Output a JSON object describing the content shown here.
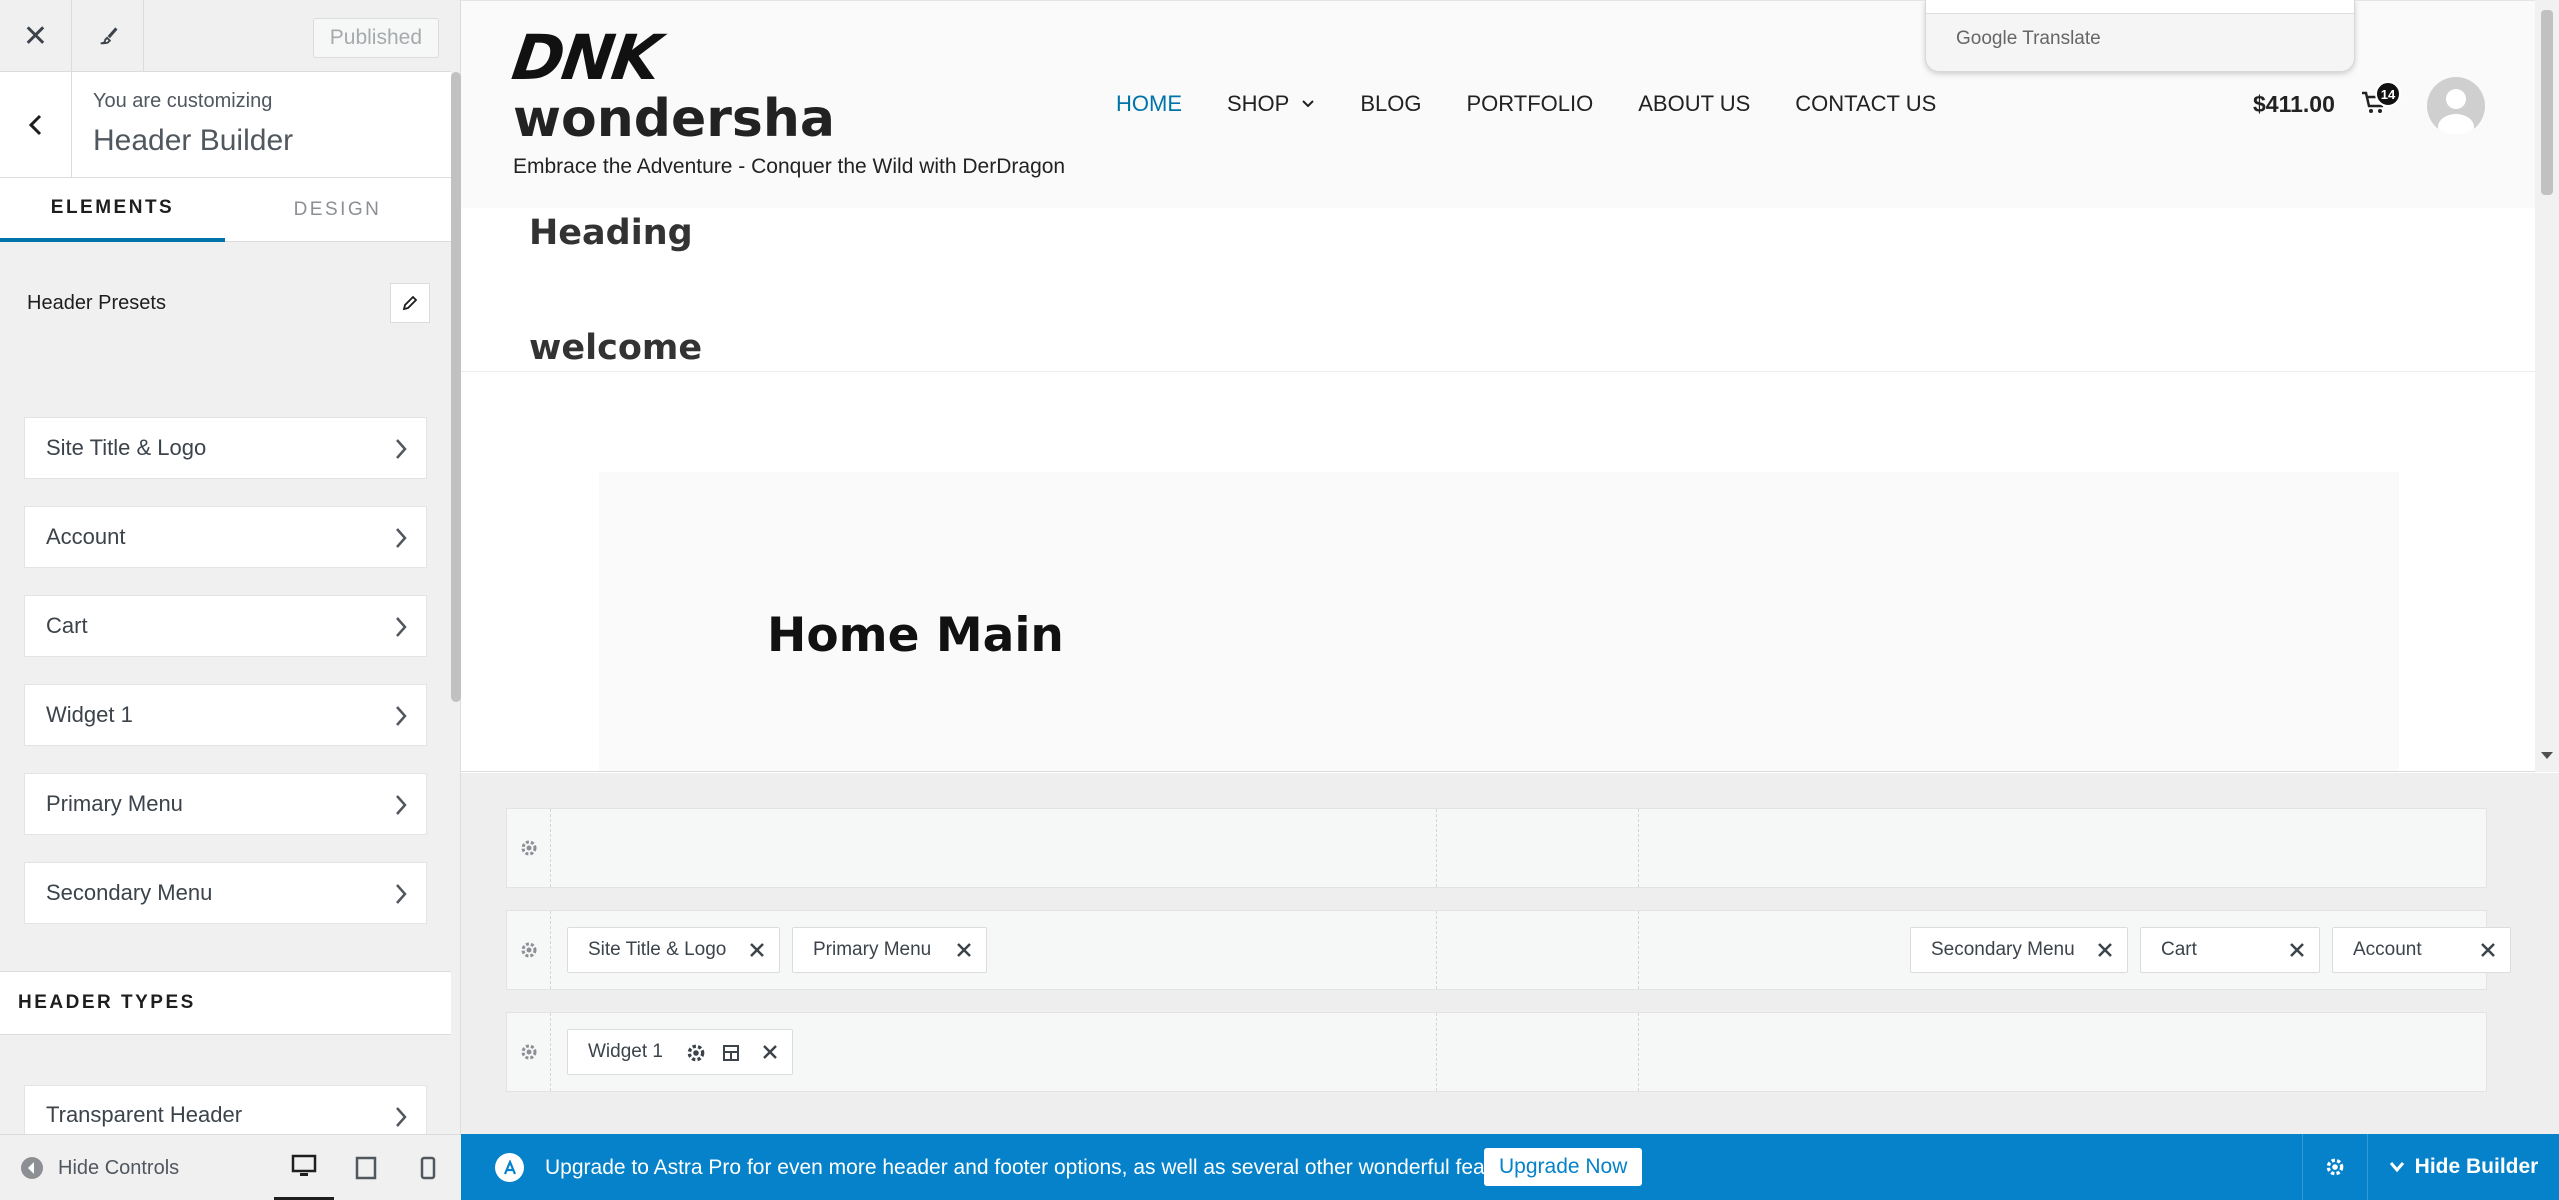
{
  "sidebar": {
    "published_label": "Published",
    "customizing_label": "You are customizing",
    "customizing_title": "Header Builder",
    "tabs": [
      {
        "label": "ELEMENTS",
        "active": true
      },
      {
        "label": "DESIGN",
        "active": false
      }
    ],
    "presets_label": "Header Presets",
    "items": [
      {
        "label": "Site Title & Logo"
      },
      {
        "label": "Account"
      },
      {
        "label": "Cart"
      },
      {
        "label": "Widget 1"
      },
      {
        "label": "Primary Menu"
      },
      {
        "label": "Secondary Menu"
      }
    ],
    "header_types_label": "HEADER TYPES",
    "header_type_items": [
      {
        "label": "Transparent Header"
      }
    ],
    "hide_controls_label": "Hide Controls",
    "devices": [
      "desktop-icon",
      "tablet-icon",
      "mobile-icon"
    ],
    "active_device": "desktop"
  },
  "preview": {
    "logo_text": "DNK",
    "site_title": "wondersha",
    "tagline": "Embrace the Adventure - Conquer the Wild with DerDragon",
    "nav": [
      {
        "label": "HOME",
        "active": true
      },
      {
        "label": "SHOP",
        "has_dropdown": true
      },
      {
        "label": "BLOG"
      },
      {
        "label": "PORTFOLIO"
      },
      {
        "label": "ABOUT US"
      },
      {
        "label": "CONTACT US"
      }
    ],
    "cart_amount": "$411.00",
    "cart_count": "14",
    "translate_label": "Google Translate",
    "heading": "Heading",
    "welcome": "welcome",
    "home_main": "Home Main"
  },
  "builder": {
    "rows": [
      {
        "name": "above-header",
        "left": [],
        "right": []
      },
      {
        "name": "primary-header",
        "left": [
          {
            "label": "Site Title & Logo"
          },
          {
            "label": "Primary Menu"
          }
        ],
        "right": [
          {
            "label": "Secondary Menu"
          },
          {
            "label": "Cart"
          },
          {
            "label": "Account"
          }
        ]
      },
      {
        "name": "below-header",
        "left": [
          {
            "label": "Widget 1"
          }
        ],
        "right": []
      }
    ]
  },
  "bottom_bar": {
    "upgrade_text": "Upgrade to Astra Pro for even more header and footer options, as well as several other wonderful features!",
    "upgrade_button": "Upgrade Now",
    "hide_builder_label": "Hide Builder"
  },
  "colors": {
    "accent": "#0073aa",
    "upgrade_bar": "#0582c9",
    "sidebar_bg": "#f0f0f1"
  }
}
